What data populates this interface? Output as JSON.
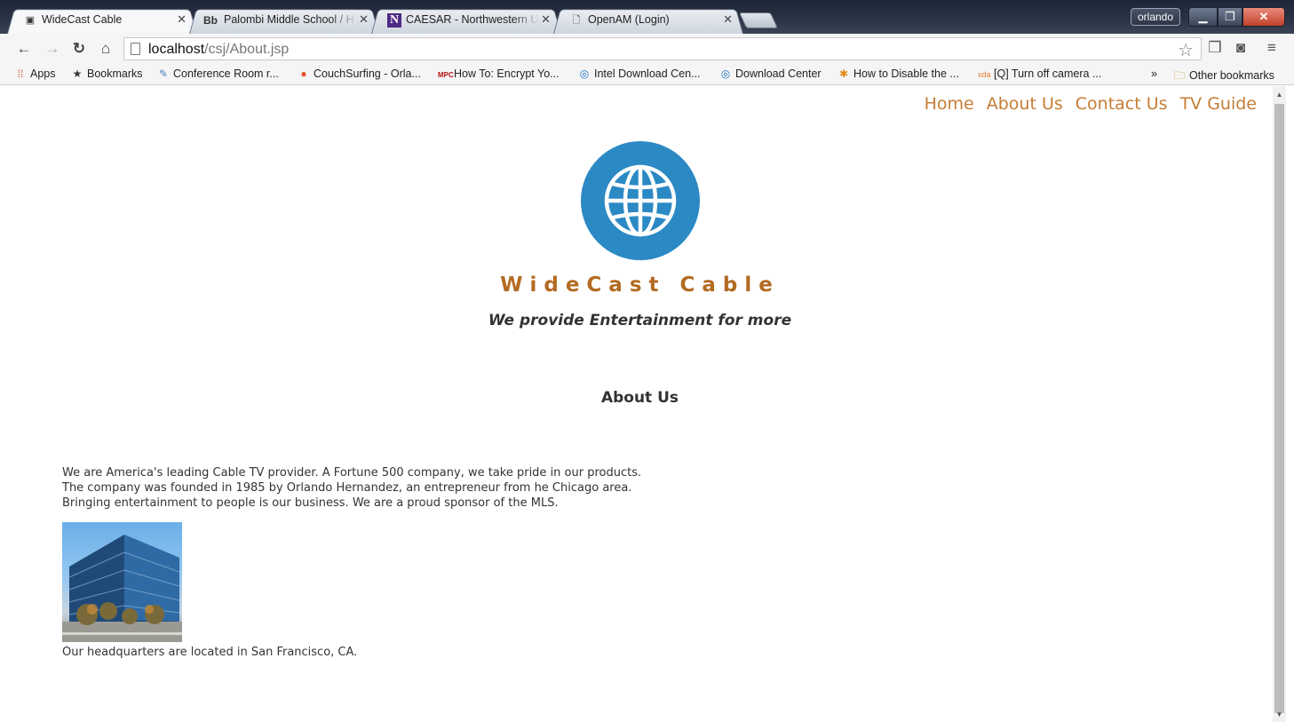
{
  "browser": {
    "tabs": [
      {
        "title": "WideCast Cable",
        "active": true,
        "favicon": "image-icon"
      },
      {
        "title": "Palombi Middle School / H",
        "active": false,
        "favicon": "Bb"
      },
      {
        "title": "CAESAR - Northwestern U",
        "active": false,
        "favicon": "N"
      },
      {
        "title": "OpenAM (Login)",
        "active": false,
        "favicon": "page-icon"
      }
    ],
    "user_name": "orlando",
    "url_host": "localhost",
    "url_path": "/csj/About.jsp",
    "bookmarks": [
      {
        "label": "Apps",
        "icon": "apps-grid-icon"
      },
      {
        "label": "Bookmarks",
        "icon": "star-icon"
      },
      {
        "label": "Conference Room r...",
        "icon": "doc-icon"
      },
      {
        "label": "CouchSurfing - Orla...",
        "icon": "couchsurfing-icon"
      },
      {
        "label": "How To: Encrypt Yo...",
        "icon": "mpc-icon"
      },
      {
        "label": "Intel Download Cen...",
        "icon": "intel-icon"
      },
      {
        "label": "Download Center",
        "icon": "intel-icon"
      },
      {
        "label": "How to Disable the ...",
        "icon": "figure-icon"
      },
      {
        "label": "[Q] Turn off camera ...",
        "icon": "xda-icon"
      },
      {
        "label": "Other bookmarks",
        "icon": "folder-icon"
      }
    ],
    "bookmarks_overflow": "»"
  },
  "site": {
    "nav": [
      "Home",
      "About Us",
      "Contact Us",
      "TV Guide"
    ],
    "brand": "WideCast Cable",
    "tagline": "We provide Entertainment for more",
    "section_title": "About Us",
    "paragraph_lines": [
      "We are America's leading Cable TV provider. A Fortune 500 company, we take pride in our products.",
      "The company was founded in 1985 by Orlando Hernandez, an entrepreneur from he Chicago area.",
      "Bringing entertainment to people is our business. We are a proud sponsor of the MLS."
    ],
    "hq_caption": "Our headquarters are located in San Francisco, CA.",
    "colors": {
      "accent": "#c57d35",
      "brand": "#b36b22",
      "logo": "#2b89c4"
    }
  }
}
